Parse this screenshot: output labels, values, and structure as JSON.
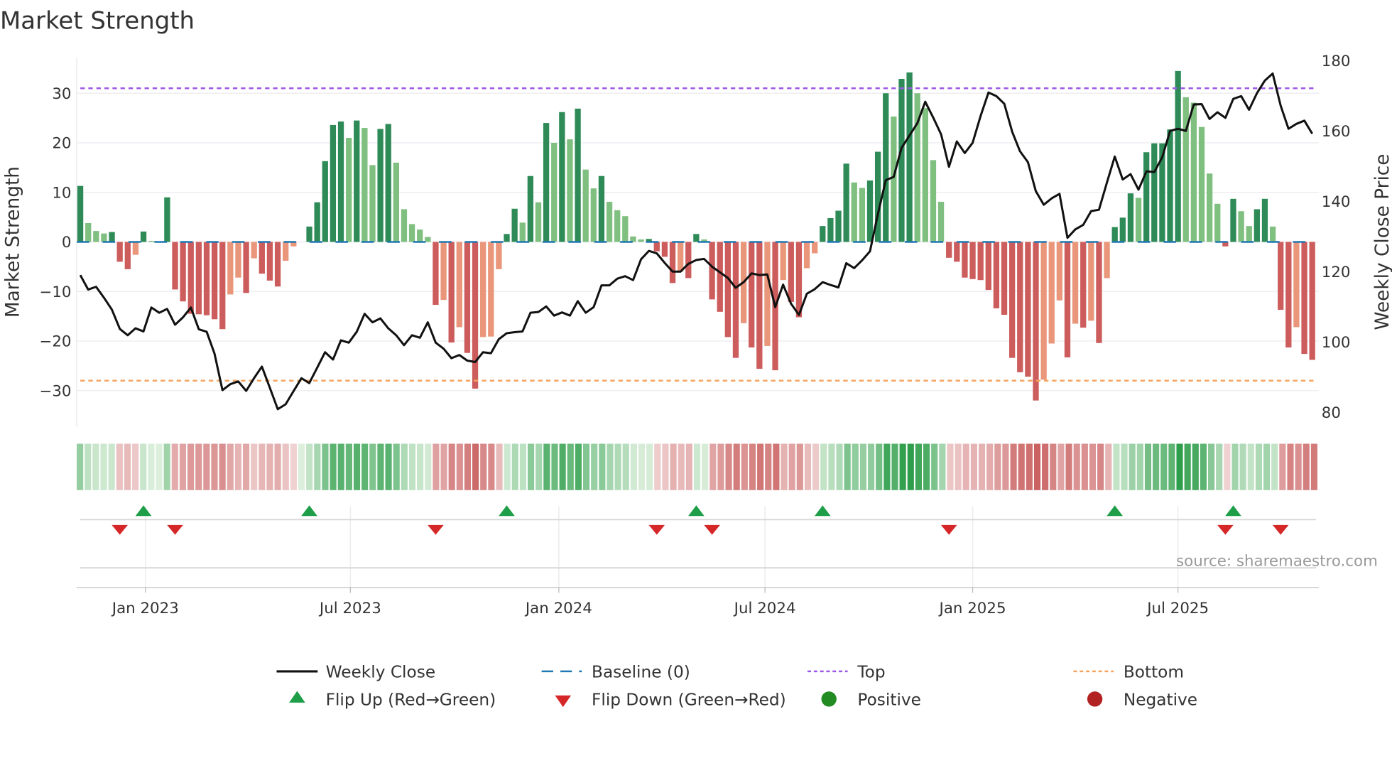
{
  "chart_data": {
    "type": "bar",
    "title": "Market Strength",
    "ylabel": "Market Strength",
    "y2label": "Weekly Close Price",
    "ylim": [
      -37.3,
      37.1
    ],
    "y2lim": [
      75.7,
      180.5
    ],
    "yticks": [
      "30",
      "20",
      "10",
      "0",
      "−10",
      "−20",
      "−30"
    ],
    "ytick_values": [
      30,
      20,
      10,
      0,
      -10,
      -20,
      -30
    ],
    "y2ticks": [
      "180",
      "160",
      "140",
      "120",
      "100",
      "80"
    ],
    "y2tick_values": [
      180,
      160,
      140,
      120,
      100,
      80
    ],
    "x_ticks": [
      {
        "label": "Jan 2023",
        "week": 8.25
      },
      {
        "label": "Jul 2023",
        "week": 34.2
      },
      {
        "label": "Jan 2024",
        "week": 60.6
      },
      {
        "label": "Jul 2024",
        "week": 86.7
      },
      {
        "label": "Jan 2025",
        "week": 113.0
      },
      {
        "label": "Jul 2025",
        "week": 139.0
      }
    ],
    "top_level": 31,
    "bottom_level": -28,
    "baseline": 0,
    "values": [
      11.3,
      3.8,
      2.2,
      1.7,
      2.0,
      -4.0,
      -5.5,
      -2.6,
      2.1,
      0.2,
      0,
      9.0,
      -9.6,
      -12.0,
      -14.5,
      -14.6,
      -14.8,
      -15.6,
      -17.6,
      -10.6,
      -7.2,
      -10.3,
      -3.3,
      -6.4,
      -7.8,
      -9.0,
      -3.8,
      -0.9,
      0,
      3.1,
      8.0,
      16.3,
      23.6,
      24.3,
      21.0,
      24.5,
      23.0,
      15.5,
      22.8,
      23.8,
      16.0,
      6.6,
      3.6,
      2.5,
      1.0,
      -12.7,
      -11.7,
      -20.3,
      -17.2,
      -22.4,
      -29.6,
      -19.2,
      -19.1,
      -5.5,
      1.6,
      6.7,
      3.9,
      13.3,
      8.0,
      24.0,
      20.0,
      26.2,
      20.7,
      26.9,
      14.6,
      10.8,
      13.3,
      8.1,
      6.4,
      5.2,
      1.1,
      0.5,
      0.6,
      -1.9,
      -3.0,
      -8.3,
      -6.0,
      -7.3,
      1.6,
      0.5,
      -11.6,
      -14.1,
      -19.2,
      -23.4,
      -16.4,
      -21.3,
      -25.6,
      -21.0,
      -25.9,
      -7.7,
      -12.1,
      -15.2,
      -5.3,
      -2.3,
      3.2,
      4.8,
      6.3,
      15.8,
      12.0,
      10.9,
      12.4,
      18.2,
      30.0,
      25.3,
      32.9,
      34.2,
      30.0,
      27.0,
      16.5,
      8.1,
      -3.2,
      -4.0,
      -7.2,
      -7.5,
      -7.7,
      -9.7,
      -13.4,
      -14.7,
      -23.4,
      -26.3,
      -27.2,
      -32.0,
      -27.8,
      -20.5,
      -11.8,
      -23.3,
      -16.5,
      -17.3,
      -15.9,
      -20.4,
      -7.3,
      3.0,
      4.9,
      9.8,
      8.9,
      18.1,
      19.9,
      19.9,
      22.7,
      34.5,
      29.2,
      28.1,
      23.2,
      13.8,
      7.7,
      -0.9,
      8.7,
      6.2,
      3.2,
      6.6,
      8.7,
      3.1,
      -13.7,
      -21.3,
      -17.2,
      -22.6,
      -23.8
    ],
    "close": [
      118.8,
      114.7,
      115.5,
      112.4,
      109.0,
      103.5,
      101.7,
      103.7,
      102.8,
      109.6,
      108.1,
      109.2,
      104.7,
      106.8,
      109.6,
      103.4,
      102.7,
      96.5,
      86.1,
      87.8,
      88.6,
      85.9,
      89.5,
      92.8,
      86.8,
      80.7,
      82.1,
      85.8,
      89.5,
      88.1,
      92.5,
      96.9,
      94.8,
      100.3,
      99.6,
      102.7,
      107.8,
      105.4,
      106.5,
      103.7,
      101.7,
      98.9,
      101.7,
      101.0,
      105.4,
      99.6,
      97.9,
      95.2,
      96.1,
      94.5,
      94.1,
      96.9,
      96.6,
      100.6,
      102.3,
      102.6,
      102.8,
      108.1,
      108.3,
      109.9,
      107.3,
      108.2,
      107.3,
      111.4,
      108.1,
      109.7,
      115.9,
      115.9,
      117.8,
      118.5,
      117.4,
      123.3,
      125.7,
      125.0,
      122.3,
      119.8,
      119.8,
      122.0,
      123.1,
      123.4,
      121.2,
      119.6,
      118.0,
      115.2,
      116.8,
      119.3,
      118.8,
      119.0,
      109.7,
      116.1,
      110.7,
      107.5,
      113.5,
      114.8,
      116.8,
      116.0,
      115.3,
      122.2,
      120.8,
      123.0,
      125.6,
      136.1,
      145.8,
      146.7,
      155.0,
      158.5,
      162.0,
      168.1,
      163.6,
      158.8,
      149.6,
      156.8,
      153.5,
      156.4,
      164.0,
      170.7,
      169.7,
      167.5,
      159.6,
      154.0,
      150.9,
      142.7,
      138.8,
      140.6,
      141.9,
      129.4,
      131.8,
      133.1,
      137.0,
      137.4,
      145.1,
      152.5,
      146.0,
      147.5,
      143.1,
      148.3,
      148.1,
      152.3,
      159.8,
      160.4,
      159.8,
      167.3,
      167.4,
      163.2,
      165.1,
      163.5,
      168.9,
      169.7,
      165.8,
      170.5,
      174.1,
      176.1,
      167.0,
      160.4,
      161.8,
      162.7,
      159.0
    ],
    "flips_up": [
      8,
      29,
      54,
      78,
      94,
      131,
      146
    ],
    "flips_down": [
      5,
      12,
      45,
      73,
      80,
      110,
      145,
      152
    ],
    "grid": true,
    "legend_placement": "bottom",
    "colors": {
      "positive_strong": "#2e8b57",
      "positive_weak": "#7fbf7f",
      "negative_strong": "#cd5c5c",
      "negative_weak": "#e9967a",
      "close": "#111111",
      "baseline": "#1f77b4",
      "top": "#9b59e6",
      "bottom": "#f4a460",
      "flip_up": "#1e9e48",
      "flip_down": "#d62728",
      "positive_dot": "#228b22",
      "negative_dot": "#b22222"
    }
  },
  "legend": {
    "weekly_close": "Weekly Close",
    "baseline": "Baseline (0)",
    "top": "Top",
    "bottom": "Bottom",
    "flip_up": "Flip Up (Red→Green)",
    "flip_down": "Flip Down (Green→Red)",
    "positive": "Positive",
    "negative": "Negative"
  },
  "source": "source: sharemaestro.com"
}
